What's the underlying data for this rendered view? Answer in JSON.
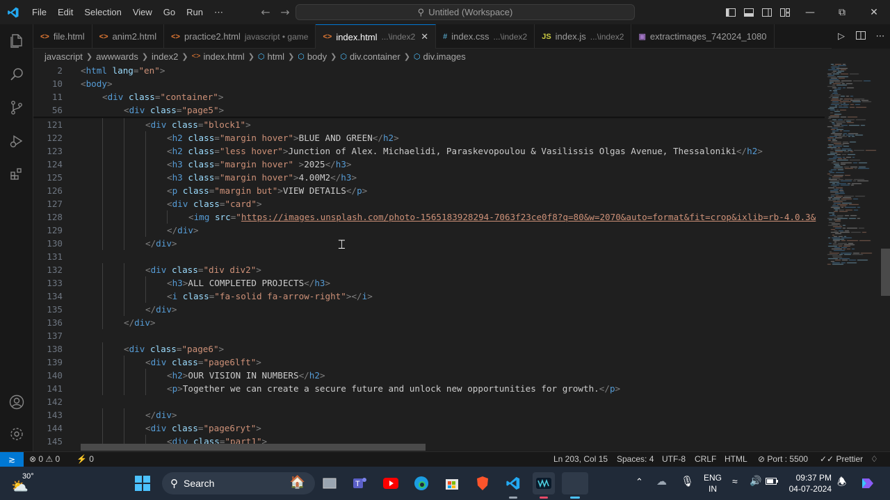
{
  "titlebar": {
    "menu": [
      "File",
      "Edit",
      "Selection",
      "View",
      "Go",
      "Run",
      "⋯"
    ],
    "search_text": "Untitled (Workspace)"
  },
  "tabs": [
    {
      "label": "file.html",
      "desc": "",
      "icon": "html-file-icon",
      "glyph": "<>",
      "color": "#e37933"
    },
    {
      "label": "anim2.html",
      "desc": "",
      "icon": "html-file-icon",
      "glyph": "<>",
      "color": "#e37933"
    },
    {
      "label": "practice2.html",
      "desc": "javascript • game",
      "icon": "html-file-icon",
      "glyph": "<>",
      "color": "#e37933"
    },
    {
      "label": "index.html",
      "desc": "...\\index2",
      "icon": "html-file-icon",
      "glyph": "<>",
      "color": "#e37933",
      "active": true
    },
    {
      "label": "index.css",
      "desc": "...\\index2",
      "icon": "css-file-icon",
      "glyph": "#",
      "color": "#519aba"
    },
    {
      "label": "index.js",
      "desc": "...\\index2",
      "icon": "js-file-icon",
      "glyph": "JS",
      "color": "#cbcb41"
    },
    {
      "label": "extractimages_742024_1080",
      "desc": "",
      "icon": "image-file-icon",
      "glyph": "▣",
      "color": "#a074c4"
    }
  ],
  "breadcrumb": [
    {
      "label": "javascript",
      "icon": ""
    },
    {
      "label": "awwwards",
      "icon": ""
    },
    {
      "label": "index2",
      "icon": ""
    },
    {
      "label": "index.html",
      "icon": "<>"
    },
    {
      "label": "html",
      "icon": "⬡"
    },
    {
      "label": "body",
      "icon": "⬡"
    },
    {
      "label": "div.container",
      "icon": "⬡"
    },
    {
      "label": "div.images",
      "icon": "⬡"
    }
  ],
  "sticky_lines": [
    {
      "n": "2",
      "indent": 0,
      "html": "<span class='p'>&lt;</span><span class='t'>html</span> <span class='a'>lang</span><span class='p'>=</span><span class='s'>\"en\"</span><span class='p'>&gt;</span>"
    },
    {
      "n": "10",
      "indent": 0,
      "html": "<span class='p'>&lt;</span><span class='t'>body</span><span class='p'>&gt;</span>"
    },
    {
      "n": "11",
      "indent": 1,
      "html": "<span class='p'>&lt;</span><span class='t'>div</span> <span class='a'>class</span><span class='p'>=</span><span class='s'>\"container\"</span><span class='p'>&gt;</span>"
    },
    {
      "n": "56",
      "indent": 2,
      "html": "<span class='p'>&lt;</span><span class='t'>div</span> <span class='a'>class</span><span class='p'>=</span><span class='s'>\"page5\"</span><span class='p'>&gt;</span>"
    }
  ],
  "lines": [
    {
      "n": "121",
      "indent": 3,
      "html": "<span class='p'>&lt;</span><span class='t'>div</span> <span class='a'>class</span><span class='p'>=</span><span class='s'>\"block1\"</span><span class='p'>&gt;</span>"
    },
    {
      "n": "122",
      "indent": 4,
      "html": "<span class='p'>&lt;</span><span class='t'>h2</span> <span class='a'>class</span><span class='p'>=</span><span class='s'>\"margin hover\"</span><span class='p'>&gt;</span>BLUE AND GREEN<span class='p'>&lt;/</span><span class='t'>h2</span><span class='p'>&gt;</span>"
    },
    {
      "n": "123",
      "indent": 4,
      "html": "<span class='p'>&lt;</span><span class='t'>h2</span> <span class='a'>class</span><span class='p'>=</span><span class='s'>\"less hover\"</span><span class='p'>&gt;</span>Junction of Alex. Michaelidi, Paraskevopoulou &amp; Vasilissis Olgas Avenue, Thessaloniki<span class='p'>&lt;/</span><span class='t'>h2</span><span class='p'>&gt;</span>"
    },
    {
      "n": "124",
      "indent": 4,
      "html": "<span class='p'>&lt;</span><span class='t'>h3</span> <span class='a'>class</span><span class='p'>=</span><span class='s'>\"margin hover\"</span> <span class='p'>&gt;</span>2025<span class='p'>&lt;/</span><span class='t'>h3</span><span class='p'>&gt;</span>"
    },
    {
      "n": "125",
      "indent": 4,
      "html": "<span class='p'>&lt;</span><span class='t'>h3</span> <span class='a'>class</span><span class='p'>=</span><span class='s'>\"margin hover\"</span><span class='p'>&gt;</span>4.00M2<span class='p'>&lt;/</span><span class='t'>h3</span><span class='p'>&gt;</span>"
    },
    {
      "n": "126",
      "indent": 4,
      "html": "<span class='p'>&lt;</span><span class='t'>p</span> <span class='a'>class</span><span class='p'>=</span><span class='s'>\"margin but\"</span><span class='p'>&gt;</span>VIEW DETAILS<span class='p'>&lt;/</span><span class='t'>p</span><span class='p'>&gt;</span>"
    },
    {
      "n": "127",
      "indent": 4,
      "html": "<span class='p'>&lt;</span><span class='t'>div</span> <span class='a'>class</span><span class='p'>=</span><span class='s'>\"card\"</span><span class='p'>&gt;</span>"
    },
    {
      "n": "128",
      "indent": 5,
      "html": "<span class='p'>&lt;</span><span class='t'>img</span> <span class='a'>src</span><span class='p'>=</span><span class='s'>\"<u>https://images.unsplash.com/photo-1565183928294-7063f23ce0f8?q=80&amp;w=2070&amp;auto=format&amp;fit=crop&amp;ixlib=rb-4.0.3&amp;</u></span>"
    },
    {
      "n": "129",
      "indent": 4,
      "html": "<span class='p'>&lt;/</span><span class='t'>div</span><span class='p'>&gt;</span>"
    },
    {
      "n": "130",
      "indent": 3,
      "html": "<span class='p'>&lt;/</span><span class='t'>div</span><span class='p'>&gt;</span>"
    },
    {
      "n": "131",
      "indent": 0,
      "html": ""
    },
    {
      "n": "132",
      "indent": 3,
      "html": "<span class='p'>&lt;</span><span class='t'>div</span> <span class='a'>class</span><span class='p'>=</span><span class='s'>\"div div2\"</span><span class='p'>&gt;</span>"
    },
    {
      "n": "133",
      "indent": 4,
      "html": "<span class='p'>&lt;</span><span class='t'>h3</span><span class='p'>&gt;</span>ALL COMPLETED PROJECTS<span class='p'>&lt;/</span><span class='t'>h3</span><span class='p'>&gt;</span>"
    },
    {
      "n": "134",
      "indent": 4,
      "html": "<span class='p'>&lt;</span><span class='t'>i</span> <span class='a'>class</span><span class='p'>=</span><span class='s'>\"fa-solid fa-arrow-right\"</span><span class='p'>&gt;&lt;/</span><span class='t'>i</span><span class='p'>&gt;</span>"
    },
    {
      "n": "135",
      "indent": 3,
      "html": "<span class='p'>&lt;/</span><span class='t'>div</span><span class='p'>&gt;</span>"
    },
    {
      "n": "136",
      "indent": 2,
      "html": "<span class='p'>&lt;/</span><span class='t'>div</span><span class='p'>&gt;</span>"
    },
    {
      "n": "137",
      "indent": 0,
      "html": ""
    },
    {
      "n": "138",
      "indent": 2,
      "html": "<span class='p'>&lt;</span><span class='t'>div</span> <span class='a'>class</span><span class='p'>=</span><span class='s'>\"page6\"</span><span class='p'>&gt;</span>"
    },
    {
      "n": "139",
      "indent": 3,
      "html": "<span class='p'>&lt;</span><span class='t'>div</span> <span class='a'>class</span><span class='p'>=</span><span class='s'>\"page6lft\"</span><span class='p'>&gt;</span>"
    },
    {
      "n": "140",
      "indent": 4,
      "html": "<span class='p'>&lt;</span><span class='t'>h2</span><span class='p'>&gt;</span>OUR VISION IN NUMBERS<span class='p'>&lt;/</span><span class='t'>h2</span><span class='p'>&gt;</span>"
    },
    {
      "n": "141",
      "indent": 4,
      "html": "<span class='p'>&lt;</span><span class='t'>p</span><span class='p'>&gt;</span>Together we can create a secure future and unlock new opportunities for growth.<span class='p'>&lt;/</span><span class='t'>p</span><span class='p'>&gt;</span>"
    },
    {
      "n": "142",
      "indent": 0,
      "html": ""
    },
    {
      "n": "143",
      "indent": 3,
      "html": "<span class='p'>&lt;/</span><span class='t'>div</span><span class='p'>&gt;</span>"
    },
    {
      "n": "144",
      "indent": 3,
      "html": "<span class='p'>&lt;</span><span class='t'>div</span> <span class='a'>class</span><span class='p'>=</span><span class='s'>\"page6ryt\"</span><span class='p'>&gt;</span>"
    },
    {
      "n": "145",
      "indent": 4,
      "html": "<span class='p'>&lt;</span><span class='t'>div</span> <span class='a'>class</span><span class='p'>=</span><span class='s'>\"part1\"</span><span class='p'>&gt;</span>"
    }
  ],
  "statusbar": {
    "problems": "⊗ 0 ⚠ 0",
    "ports": "⚡ 0",
    "position": "Ln 203, Col 15",
    "spaces": "Spaces: 4",
    "encoding": "UTF-8",
    "eol": "CRLF",
    "language": "HTML",
    "port": "Port : 5500",
    "prettier": "✓✓ Prettier"
  },
  "taskbar": {
    "weather": "30°",
    "search": "Search",
    "lang1": "ENG",
    "lang2": "IN",
    "time": "09:37 PM",
    "date": "04-07-2024"
  },
  "colors": {
    "tag": "#569cd6",
    "attr": "#9cdcfe",
    "string": "#ce9178",
    "punct": "#808080",
    "accent": "#0078d4"
  }
}
